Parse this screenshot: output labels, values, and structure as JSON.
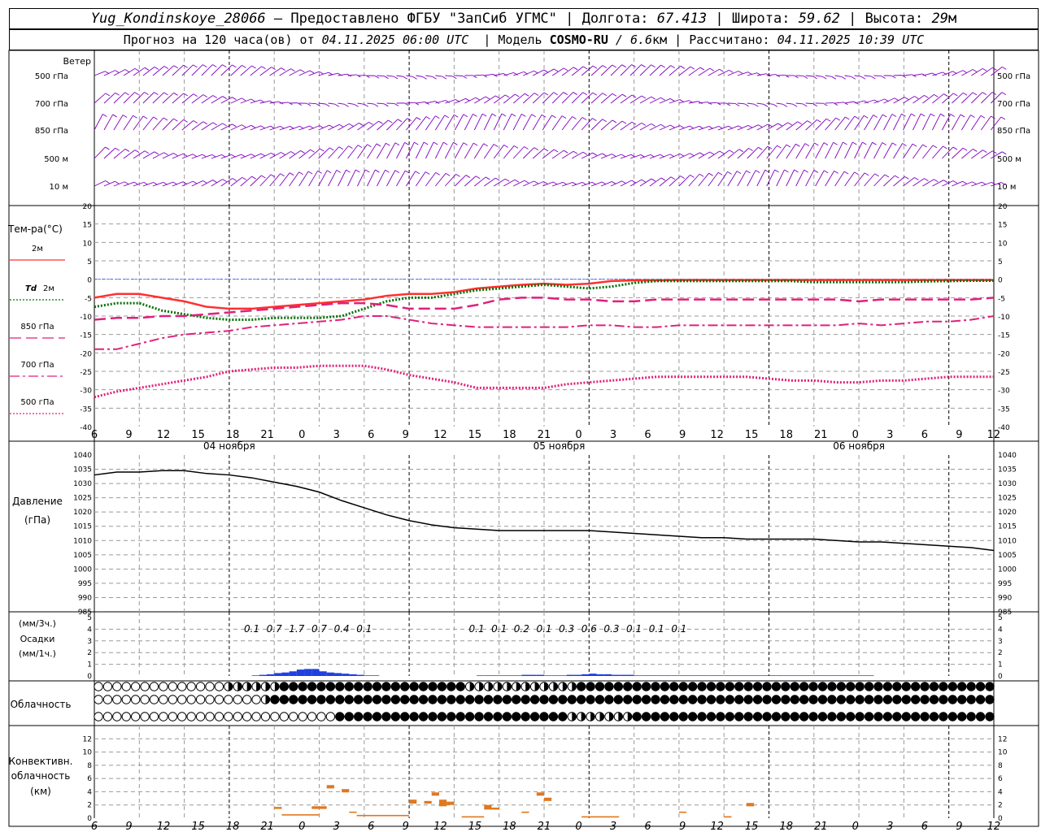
{
  "header": {
    "station": "Yug_Kondinskoye_28066",
    "provider_text": " – Предоставлено ФГБУ \"ЗапСиб УГМС\" | Долгота: ",
    "longitude": "67.413",
    "lat_label": " | Широта: ",
    "latitude": "59.62",
    "alt_label": " | Высота: ",
    "altitude": "29",
    "alt_unit": "м",
    "forecast_label": "Прогноз на 120 часа(ов) от ",
    "forecast_start": "04.11.2025 06:00 UTC",
    "model_label": "  | Модель ",
    "model_name": "COSMO-RU",
    "model_res": " / 6.6",
    "model_res_unit": "км",
    "calc_label": " | Рассчитано: ",
    "calc_time": "04.11.2025 10:39 UTC"
  },
  "colors": {
    "wind": "#8000c0",
    "t2m": "#ff3030",
    "td2m": "#007000",
    "t850": "#e0207a",
    "t700": "#e0207a",
    "t500": "#e0207a",
    "zero_line": "#4060ff",
    "pressure": "#000000",
    "precip": "#2040e0",
    "convective": "#e07820",
    "grid": "#999999"
  },
  "icons": {
    "cloud_clear": "empty-circle",
    "cloud_partial": "half-filled-circle",
    "cloud_overcast": "filled-circle"
  },
  "chart_data": [
    {
      "type": "line",
      "title": "Ветер",
      "levels": [
        "500 гПа",
        "700 гПа",
        "850 гПа",
        "500 м",
        "10 м"
      ],
      "x_hours": [
        0,
        120
      ],
      "x_ticks": [
        "6",
        "9",
        "12",
        "15",
        "18",
        "21",
        "0",
        "3",
        "6",
        "9",
        "12",
        "15",
        "18",
        "21",
        "0",
        "3",
        "6",
        "9",
        "12",
        "15",
        "18",
        "21",
        "0",
        "3",
        "6",
        "9",
        "12"
      ],
      "note_levels": "wind barbs"
    },
    {
      "type": "line",
      "ylabel": "Тем-ра(°C)",
      "ylim": [
        -40,
        20
      ],
      "y_ticks": [
        "20",
        "15",
        "10",
        "5",
        "0",
        "-5",
        "-10",
        "-15",
        "-20",
        "-25",
        "-30",
        "-35",
        "-40"
      ],
      "x_ticks": [
        "6",
        "9",
        "12",
        "15",
        "18",
        "21",
        "0",
        "3",
        "6",
        "9",
        "12",
        "15",
        "18",
        "21",
        "0",
        "3",
        "6",
        "9",
        "12",
        "15",
        "18",
        "21",
        "0",
        "3",
        "6",
        "9",
        "12"
      ],
      "date_labels": [
        "04 ноября",
        "05 ноября",
        "06 ноября"
      ],
      "x": [
        0,
        3,
        6,
        9,
        12,
        15,
        18,
        21,
        24,
        27,
        30,
        33,
        36,
        39,
        42,
        45,
        48,
        51,
        54,
        57,
        60,
        63,
        66,
        69,
        72,
        75,
        78,
        81,
        84,
        87,
        90,
        93,
        96,
        99,
        102,
        105,
        108,
        111,
        114,
        117,
        120
      ],
      "series": [
        {
          "name": "2м",
          "legend": "2м",
          "style": "solid",
          "values": [
            -5,
            -4,
            -4,
            -5,
            -6,
            -7.5,
            -8,
            -8,
            -7.5,
            -7,
            -6.5,
            -6,
            -5.5,
            -4.5,
            -4,
            -4,
            -3.5,
            -2.5,
            -2,
            -1.5,
            -1.2,
            -1.5,
            -1.2,
            -0.5,
            -0.3,
            -0.3,
            -0.2,
            -0.2,
            -0.2,
            -0.2,
            -0.2,
            -0.2,
            -0.2,
            -0.2,
            -0.2,
            -0.2,
            -0.2,
            -0.2,
            -0.2,
            -0.2,
            -0.2
          ]
        },
        {
          "name": "Td 2м",
          "legend": "Td",
          "legend2": "2м",
          "style": "dotted",
          "values": [
            -7.5,
            -6.5,
            -6.5,
            -8.5,
            -9.5,
            -10.5,
            -11,
            -11,
            -10.5,
            -10.5,
            -10.5,
            -10,
            -8,
            -6,
            -5,
            -5,
            -4,
            -3,
            -2.5,
            -2,
            -1.5,
            -2,
            -2.5,
            -2,
            -1,
            -0.5,
            -0.5,
            -0.5,
            -0.5,
            -0.5,
            -0.5,
            -0.5,
            -0.8,
            -0.8,
            -0.8,
            -0.8,
            -0.8,
            -0.6,
            -0.5,
            -0.4,
            -0.4
          ]
        },
        {
          "name": "850 гПа",
          "legend": "850 гПа",
          "style": "dashed",
          "values": [
            -11,
            -10.5,
            -10.5,
            -10,
            -10,
            -9.5,
            -9,
            -8.5,
            -8,
            -7.5,
            -7,
            -6.5,
            -6.5,
            -7,
            -8,
            -8,
            -8,
            -7,
            -5.5,
            -5,
            -5,
            -5.5,
            -5.5,
            -6,
            -6,
            -5.5,
            -5.5,
            -5.5,
            -5.5,
            -5.5,
            -5.5,
            -5.5,
            -5.5,
            -5.5,
            -6,
            -5.5,
            -5.5,
            -5.5,
            -5.5,
            -5.5,
            -5
          ]
        },
        {
          "name": "700 гПа",
          "legend": "700 гПа",
          "style": "dashdot",
          "values": [
            -19,
            -19,
            -17.5,
            -16,
            -15,
            -14.5,
            -14,
            -13,
            -12.5,
            -12,
            -11.5,
            -11,
            -10,
            -10,
            -11,
            -12,
            -12.5,
            -13,
            -13,
            -13,
            -13,
            -13,
            -12.5,
            -12.5,
            -13,
            -13,
            -12.5,
            -12.5,
            -12.5,
            -12.5,
            -12.5,
            -12.5,
            -12.5,
            -12.5,
            -12,
            -12.5,
            -12,
            -11.5,
            -11.5,
            -11,
            -10
          ]
        },
        {
          "name": "500 гПа",
          "legend": "500 гПа",
          "style": "dotted",
          "values": [
            -32,
            -30.5,
            -29.5,
            -28.5,
            -27.5,
            -26.5,
            -25,
            -24.5,
            -24,
            -24,
            -23.5,
            -23.5,
            -23.5,
            -24.5,
            -26,
            -27,
            -28,
            -29.5,
            -29.5,
            -29.5,
            -29.5,
            -28.5,
            -28,
            -27.5,
            -27,
            -26.5,
            -26.5,
            -26.5,
            -26.5,
            -26.5,
            -27,
            -27.5,
            -27.5,
            -28,
            -28,
            -27.5,
            -27.5,
            -27,
            -26.5,
            -26.5,
            -26.5
          ]
        }
      ]
    },
    {
      "type": "line",
      "ylabel": "Давление",
      "ylabel2": "(гПа)",
      "ylim": [
        985,
        1040
      ],
      "y_ticks": [
        "1040",
        "1035",
        "1030",
        "1025",
        "1020",
        "1015",
        "1010",
        "1005",
        "1000",
        "995",
        "990",
        "985"
      ],
      "x": [
        0,
        3,
        6,
        9,
        12,
        15,
        18,
        21,
        24,
        27,
        30,
        33,
        36,
        39,
        42,
        45,
        48,
        51,
        54,
        57,
        60,
        63,
        66,
        69,
        72,
        75,
        78,
        81,
        84,
        87,
        90,
        93,
        96,
        99,
        102,
        105,
        108,
        111,
        114,
        117,
        120
      ],
      "series": [
        {
          "name": "Давление",
          "values": [
            1033,
            1034,
            1034,
            1034.5,
            1034.5,
            1033.5,
            1033,
            1032,
            1030.5,
            1029,
            1027,
            1024,
            1021.5,
            1019,
            1017,
            1015.5,
            1014.5,
            1014,
            1013.5,
            1013.5,
            1013.5,
            1013.5,
            1013.5,
            1013,
            1012.5,
            1012,
            1011.5,
            1011,
            1011,
            1010.5,
            1010.5,
            1010.5,
            1010.5,
            1010,
            1009.5,
            1009.5,
            1009,
            1008.5,
            1008,
            1007.5,
            1006.5
          ]
        }
      ]
    },
    {
      "type": "bar",
      "ylabel": "(мм/3ч.)",
      "ylabel2": "Осадки",
      "ylabel3": "(мм/1ч.)",
      "ylim": [
        0,
        5
      ],
      "y_ticks": [
        "5",
        "4",
        "3",
        "2",
        "1",
        "0"
      ],
      "totals_3h": [
        {
          "t": 21,
          "label": "0.1"
        },
        {
          "t": 24,
          "label": "0.7"
        },
        {
          "t": 27,
          "label": "1.7"
        },
        {
          "t": 30,
          "label": "0.7"
        },
        {
          "t": 33,
          "label": "0.4"
        },
        {
          "t": 36,
          "label": "0.1"
        },
        {
          "t": 51,
          "label": "0.1"
        },
        {
          "t": 54,
          "label": "0.1"
        },
        {
          "t": 57,
          "label": "0.2"
        },
        {
          "t": 60,
          "label": "0.1"
        },
        {
          "t": 63,
          "label": "0.3"
        },
        {
          "t": 66,
          "label": "0.6"
        },
        {
          "t": 69,
          "label": "0.3"
        },
        {
          "t": 72,
          "label": "0.1"
        },
        {
          "t": 75,
          "label": "0.1"
        },
        {
          "t": 78,
          "label": "0.1"
        }
      ],
      "hourly": [
        [
          22,
          0.05
        ],
        [
          23,
          0.1
        ],
        [
          24,
          0.15
        ],
        [
          25,
          0.25
        ],
        [
          26,
          0.3
        ],
        [
          27,
          0.4
        ],
        [
          28,
          0.55
        ],
        [
          29,
          0.6
        ],
        [
          30,
          0.6
        ],
        [
          31,
          0.4
        ],
        [
          32,
          0.3
        ],
        [
          33,
          0.25
        ],
        [
          34,
          0.2
        ],
        [
          35,
          0.15
        ],
        [
          36,
          0.1
        ],
        [
          37,
          0.05
        ],
        [
          38,
          0.05
        ],
        [
          52,
          0.05
        ],
        [
          53,
          0.05
        ],
        [
          54,
          0.05
        ],
        [
          55,
          0.05
        ],
        [
          56,
          0.05
        ],
        [
          57,
          0.05
        ],
        [
          58,
          0.1
        ],
        [
          59,
          0.1
        ],
        [
          60,
          0.1
        ],
        [
          61,
          0.05
        ],
        [
          62,
          0.05
        ],
        [
          63,
          0.05
        ],
        [
          64,
          0.1
        ],
        [
          65,
          0.1
        ],
        [
          66,
          0.15
        ],
        [
          67,
          0.2
        ],
        [
          68,
          0.15
        ],
        [
          69,
          0.15
        ],
        [
          70,
          0.1
        ],
        [
          71,
          0.1
        ],
        [
          72,
          0.1
        ],
        [
          73,
          0.05
        ],
        [
          74,
          0.05
        ],
        [
          75,
          0.05
        ],
        [
          76,
          0.05
        ],
        [
          77,
          0.05
        ],
        [
          78,
          0.05
        ],
        [
          79,
          0.05
        ],
        [
          80,
          0.05
        ],
        [
          81,
          0.05
        ],
        [
          82,
          0.05
        ],
        [
          83,
          0.05
        ],
        [
          84,
          0.05
        ],
        [
          85,
          0.05
        ],
        [
          86,
          0.05
        ],
        [
          87,
          0.05
        ],
        [
          88,
          0.05
        ],
        [
          89,
          0.05
        ],
        [
          90,
          0.05
        ],
        [
          91,
          0.05
        ],
        [
          92,
          0.05
        ],
        [
          93,
          0.05
        ],
        [
          94,
          0.05
        ],
        [
          95,
          0.05
        ],
        [
          96,
          0.05
        ],
        [
          97,
          0.05
        ],
        [
          98,
          0.05
        ],
        [
          99,
          0.05
        ],
        [
          100,
          0.05
        ],
        [
          101,
          0.05
        ],
        [
          102,
          0.05
        ],
        [
          103,
          0.05
        ],
        [
          104,
          0.05
        ]
      ]
    },
    {
      "type": "heatmap",
      "ylabel": "Облачность",
      "rows": [
        "0000000000000011111122222222222222222222111111111111222222222222222222222222222222222222222222222",
        "0000000000000000001222222222222222222222222222222222222222222222222222222222222222222222222222222",
        "0000000000000000000000000022222222222222222222222221111111222222222222222222222222222222222222222"
      ]
    },
    {
      "type": "bar",
      "ylabel": "Конвективн.",
      "ylabel2": "облачность",
      "ylabel3": "(км)",
      "ylim": [
        0,
        14
      ],
      "y_ticks": [
        "12",
        "10",
        "8",
        "6",
        "4",
        "2",
        "0"
      ],
      "x_ticks": [
        "6",
        "9",
        "12",
        "15",
        "18",
        "21",
        "0",
        "3",
        "6",
        "9",
        "12",
        "15",
        "18",
        "21",
        "0",
        "3",
        "6",
        "9",
        "12",
        "15",
        "18",
        "21",
        "0",
        "3",
        "6",
        "9",
        "12"
      ],
      "segments": [
        {
          "t0": 24,
          "t1": 25,
          "base": 1.4,
          "top": 1.7
        },
        {
          "t0": 25,
          "t1": 30,
          "base": 0.4,
          "top": 0.6
        },
        {
          "t0": 29,
          "t1": 31,
          "base": 1.4,
          "top": 1.8
        },
        {
          "t0": 31,
          "t1": 32,
          "base": 4.5,
          "top": 5.0
        },
        {
          "t0": 33,
          "t1": 34,
          "base": 3.9,
          "top": 4.4
        },
        {
          "t0": 34,
          "t1": 35,
          "base": 0.8,
          "top": 1.0
        },
        {
          "t0": 35,
          "t1": 42,
          "base": 0.3,
          "top": 0.5
        },
        {
          "t0": 42,
          "t1": 43,
          "base": 2.2,
          "top": 2.8
        },
        {
          "t0": 44,
          "t1": 45,
          "base": 2.2,
          "top": 2.6
        },
        {
          "t0": 45,
          "t1": 46,
          "base": 3.4,
          "top": 3.9
        },
        {
          "t0": 46,
          "t1": 47,
          "base": 1.8,
          "top": 2.8
        },
        {
          "t0": 47,
          "t1": 48,
          "base": 2.0,
          "top": 2.5
        },
        {
          "t0": 49,
          "t1": 52,
          "base": 0.1,
          "top": 0.3
        },
        {
          "t0": 52,
          "t1": 53,
          "base": 1.3,
          "top": 2.0
        },
        {
          "t0": 53,
          "t1": 54,
          "base": 1.3,
          "top": 1.6
        },
        {
          "t0": 57,
          "t1": 58,
          "base": 0.8,
          "top": 1.0
        },
        {
          "t0": 59,
          "t1": 60,
          "base": 3.4,
          "top": 3.9
        },
        {
          "t0": 60,
          "t1": 61,
          "base": 2.6,
          "top": 3.1
        },
        {
          "t0": 65,
          "t1": 70,
          "base": 0.1,
          "top": 0.3
        },
        {
          "t0": 78,
          "t1": 79,
          "base": 0.8,
          "top": 1.0
        },
        {
          "t0": 84,
          "t1": 85,
          "base": 0.1,
          "top": 0.3
        },
        {
          "t0": 87,
          "t1": 88,
          "base": 1.8,
          "top": 2.3
        }
      ]
    }
  ]
}
